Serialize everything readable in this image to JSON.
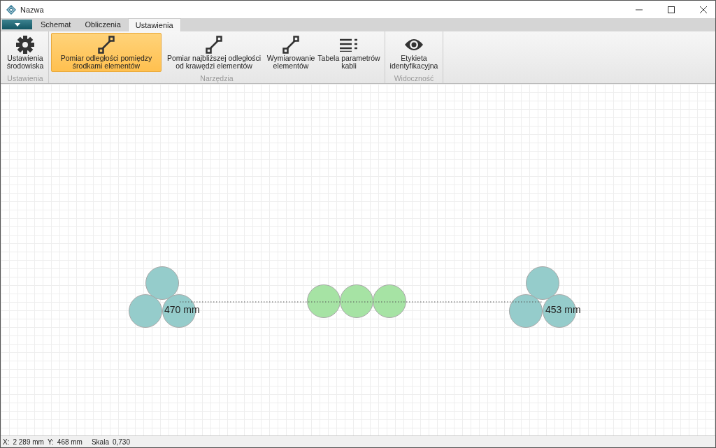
{
  "window": {
    "title": "Nazwa"
  },
  "tabs": [
    {
      "label": "Schemat",
      "selected": false
    },
    {
      "label": "Obliczenia",
      "selected": false
    },
    {
      "label": "Ustawienia",
      "selected": true
    }
  ],
  "ribbon": [
    {
      "label": "Ustawienia",
      "buttons": [
        {
          "kind": "gear",
          "label": "Ustawienia środowiska",
          "selected": false
        }
      ]
    },
    {
      "label": "Narzędzia",
      "buttons": [
        {
          "kind": "measure",
          "label": "Pomiar odległości pomiędzy środkami elementów",
          "selected": true
        },
        {
          "kind": "measure",
          "label": "Pomiar najbliższej odległości od krawędzi elementów",
          "selected": false
        },
        {
          "kind": "measure",
          "label": "Wymiarowanie elementów",
          "selected": false
        },
        {
          "kind": "list",
          "label": "Tabela parametrów kabli",
          "selected": false
        }
      ]
    },
    {
      "label": "Widoczność",
      "buttons": [
        {
          "kind": "eye",
          "label": "Etykieta identyfikacyjna",
          "selected": false
        }
      ]
    }
  ],
  "canvas": {
    "groups": [
      {
        "kind": "triangle",
        "color": "#95cccb"
      },
      {
        "kind": "row",
        "color": "#a6e3a4"
      },
      {
        "kind": "triangle",
        "color": "#95cccb"
      }
    ],
    "measurements": [
      "470 mm",
      "453 mm"
    ]
  },
  "status_bar": {
    "x_label": "X:",
    "x": "2 289 mm",
    "y_label": "Y:",
    "y": "468 mm",
    "scale_label": "Skala",
    "scale": "0,730"
  }
}
